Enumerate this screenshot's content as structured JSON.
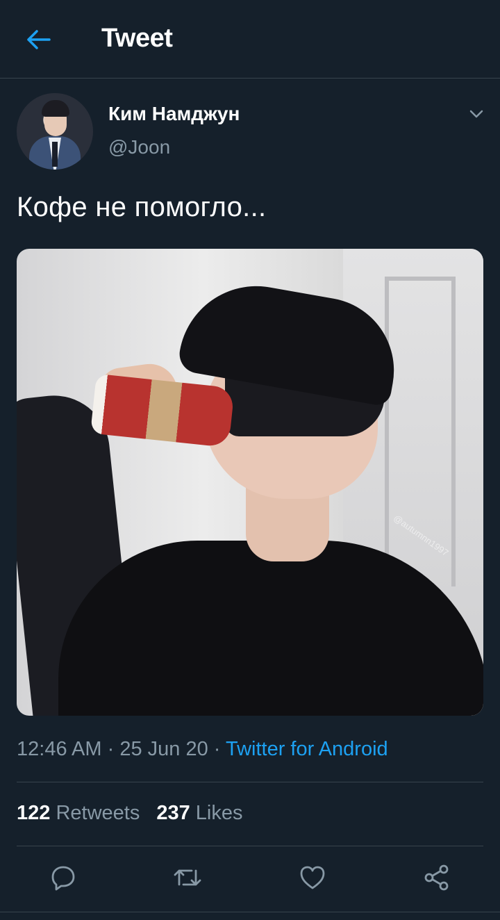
{
  "colors": {
    "background": "#15202b",
    "accent": "#1da1f2",
    "secondary_text": "#8899a6",
    "divider": "#38444d"
  },
  "header": {
    "back_icon": "arrow-left-icon",
    "title": "Tweet"
  },
  "author": {
    "name": "Ким Намджун",
    "handle": "@Joon",
    "more_icon": "chevron-down-icon"
  },
  "tweet": {
    "text": "Кофе не помогло...",
    "media_watermark": "@autumnn1997"
  },
  "meta": {
    "time": "12:46 AM",
    "separator1": " · ",
    "date": "25 Jun 20",
    "separator2": " · ",
    "source": "Twitter for Android"
  },
  "stats": {
    "retweets_count": "122",
    "retweets_label": "Retweets",
    "likes_count": "237",
    "likes_label": "Likes"
  },
  "actions": [
    {
      "name": "reply",
      "icon": "reply-icon"
    },
    {
      "name": "retweet",
      "icon": "retweet-icon"
    },
    {
      "name": "like",
      "icon": "heart-icon"
    },
    {
      "name": "share",
      "icon": "share-icon"
    }
  ]
}
